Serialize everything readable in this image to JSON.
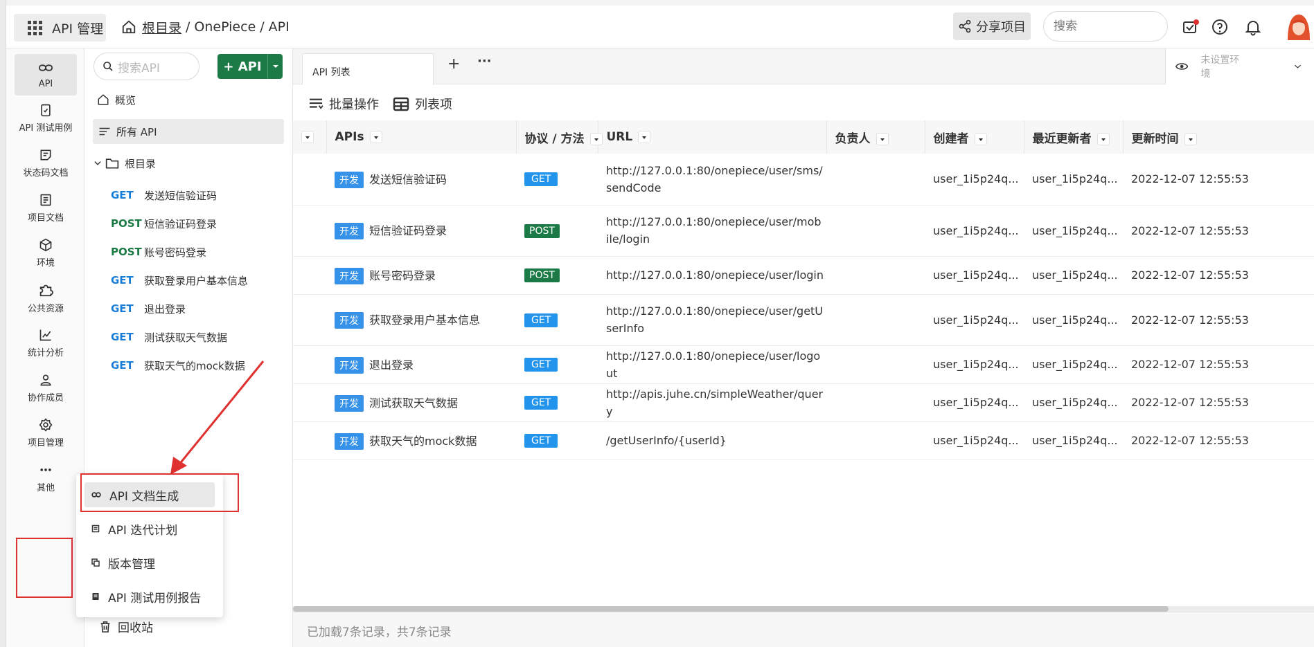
{
  "header": {
    "app_label": "API 管理",
    "breadcrumb": {
      "root": "根目录",
      "project": "OnePiece",
      "current": "API"
    },
    "share_label": "分享项目",
    "search_placeholder": "搜索"
  },
  "rail": {
    "items": [
      {
        "label": "API",
        "icon": "link-icon"
      },
      {
        "label": "API 测试用例",
        "icon": "clipboard-check-icon"
      },
      {
        "label": "状态码文档",
        "icon": "note-icon"
      },
      {
        "label": "项目文档",
        "icon": "document-icon"
      },
      {
        "label": "环境",
        "icon": "cube-icon"
      },
      {
        "label": "公共资源",
        "icon": "puzzle-icon"
      },
      {
        "label": "统计分析",
        "icon": "chart-icon"
      },
      {
        "label": "协作成员",
        "icon": "users-icon"
      },
      {
        "label": "项目管理",
        "icon": "gear-icon"
      },
      {
        "label": "其他",
        "icon": "more-icon"
      }
    ]
  },
  "tree": {
    "search_placeholder": "搜索API",
    "add_label": "+ API",
    "overview": "概览",
    "all_api": "所有 API",
    "root_folder": "根目录",
    "apis": [
      {
        "method": "GET",
        "name": "发送短信验证码"
      },
      {
        "method": "POST",
        "name": "短信验证码登录"
      },
      {
        "method": "POST",
        "name": "账号密码登录"
      },
      {
        "method": "GET",
        "name": "获取登录用户基本信息"
      },
      {
        "method": "GET",
        "name": "退出登录"
      },
      {
        "method": "GET",
        "name": "测试获取天气数据"
      },
      {
        "method": "GET",
        "name": "获取天气的mock数据"
      }
    ],
    "trash": "回收站"
  },
  "popup": {
    "items": [
      "API 文档生成",
      "API 迭代计划",
      "版本管理",
      "API 测试用例报告"
    ]
  },
  "main": {
    "tab_label": "API 列表",
    "tab_add": "+",
    "tab_more": "···",
    "env_label": "未设置环境",
    "toolbar": {
      "batch": "批量操作",
      "columns": "列表项"
    },
    "columns": [
      "APIs",
      "协议 / 方法",
      "URL",
      "负责人",
      "创建者",
      "最近更新者",
      "更新时间"
    ],
    "rows": [
      {
        "tag": "开发",
        "name": "发送短信验证码",
        "method": "GET",
        "url": "http://127.0.0.1:80/onepiece/user/sms/sendCode",
        "owner": "",
        "creator": "user_1i5p24q...",
        "updater": "user_1i5p24q...",
        "time": "2022-12-07 12:55:53"
      },
      {
        "tag": "开发",
        "name": "短信验证码登录",
        "method": "POST",
        "url": "http://127.0.0.1:80/onepiece/user/mobile/login",
        "owner": "",
        "creator": "user_1i5p24q...",
        "updater": "user_1i5p24q...",
        "time": "2022-12-07 12:55:53"
      },
      {
        "tag": "开发",
        "name": "账号密码登录",
        "method": "POST",
        "url": "http://127.0.0.1:80/onepiece/user/login",
        "owner": "",
        "creator": "user_1i5p24q...",
        "updater": "user_1i5p24q...",
        "time": "2022-12-07 12:55:53"
      },
      {
        "tag": "开发",
        "name": "获取登录用户基本信息",
        "method": "GET",
        "url": "http://127.0.0.1:80/onepiece/user/getUserInfo",
        "owner": "",
        "creator": "user_1i5p24q...",
        "updater": "user_1i5p24q...",
        "time": "2022-12-07 12:55:53"
      },
      {
        "tag": "开发",
        "name": "退出登录",
        "method": "GET",
        "url": "http://127.0.0.1:80/onepiece/user/logout",
        "owner": "",
        "creator": "user_1i5p24q...",
        "updater": "user_1i5p24q...",
        "time": "2022-12-07 12:55:53"
      },
      {
        "tag": "开发",
        "name": "测试获取天气数据",
        "method": "GET",
        "url": "http://apis.juhe.cn/simpleWeather/query",
        "owner": "",
        "creator": "user_1i5p24q...",
        "updater": "user_1i5p24q...",
        "time": "2022-12-07 12:55:53"
      },
      {
        "tag": "开发",
        "name": "获取天气的mock数据",
        "method": "GET",
        "url": "/getUserInfo/{userId}",
        "owner": "",
        "creator": "user_1i5p24q...",
        "updater": "user_1i5p24q...",
        "time": "2022-12-07 12:55:53"
      }
    ],
    "footer": "已加载7条记录，共7条记录"
  },
  "colors": {
    "brand_green": "#1c7a46",
    "get_blue": "#2294ec",
    "dev_blue": "#3592e8",
    "highlight_red": "#e03131"
  }
}
